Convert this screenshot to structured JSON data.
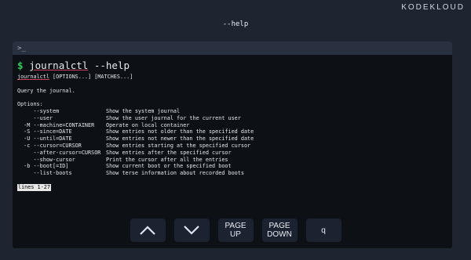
{
  "brand": "KODEKLOUD",
  "slide_title": "--help",
  "terminal": {
    "prompt_glyph": ">_",
    "command_prompt": "$",
    "command_name": "journalctl",
    "command_args": " --help",
    "usage_cmd": "journalctl",
    "usage_rest": " [OPTIONS...] [MATCHES...]",
    "description": "Query the journal.",
    "options_header": "Options:",
    "options": [
      {
        "opt": "     --system",
        "desc": "Show the system journal"
      },
      {
        "opt": "     --user",
        "desc": "Show the user journal for the current user"
      },
      {
        "opt": "  -M --machine=CONTAINER",
        "desc": "Operate on local container"
      },
      {
        "opt": "  -S --since=DATE",
        "desc": "Show entries not older than the specified date"
      },
      {
        "opt": "  -U --until=DATE",
        "desc": "Show entries not newer than the specified date"
      },
      {
        "opt": "  -c --cursor=CURSOR",
        "desc": "Show entries starting at the specified cursor"
      },
      {
        "opt": "     --after-cursor=CURSOR",
        "desc": "Show entries after the specified cursor"
      },
      {
        "opt": "     --show-cursor",
        "desc": "Print the cursor after all the entries"
      },
      {
        "opt": "  -b --boot[=ID]",
        "desc": "Show current boot or the specified boot"
      },
      {
        "opt": "     --list-boots",
        "desc": "Show terse information about recorded boots"
      }
    ],
    "pager_status": "lines 1-27"
  },
  "controls": {
    "up_icon": "chevron-up-icon",
    "down_icon": "chevron-down-icon",
    "page_up_line1": "PAGE",
    "page_up_line2": "UP",
    "page_down_line1": "PAGE",
    "page_down_line2": "DOWN",
    "quit": "q"
  }
}
